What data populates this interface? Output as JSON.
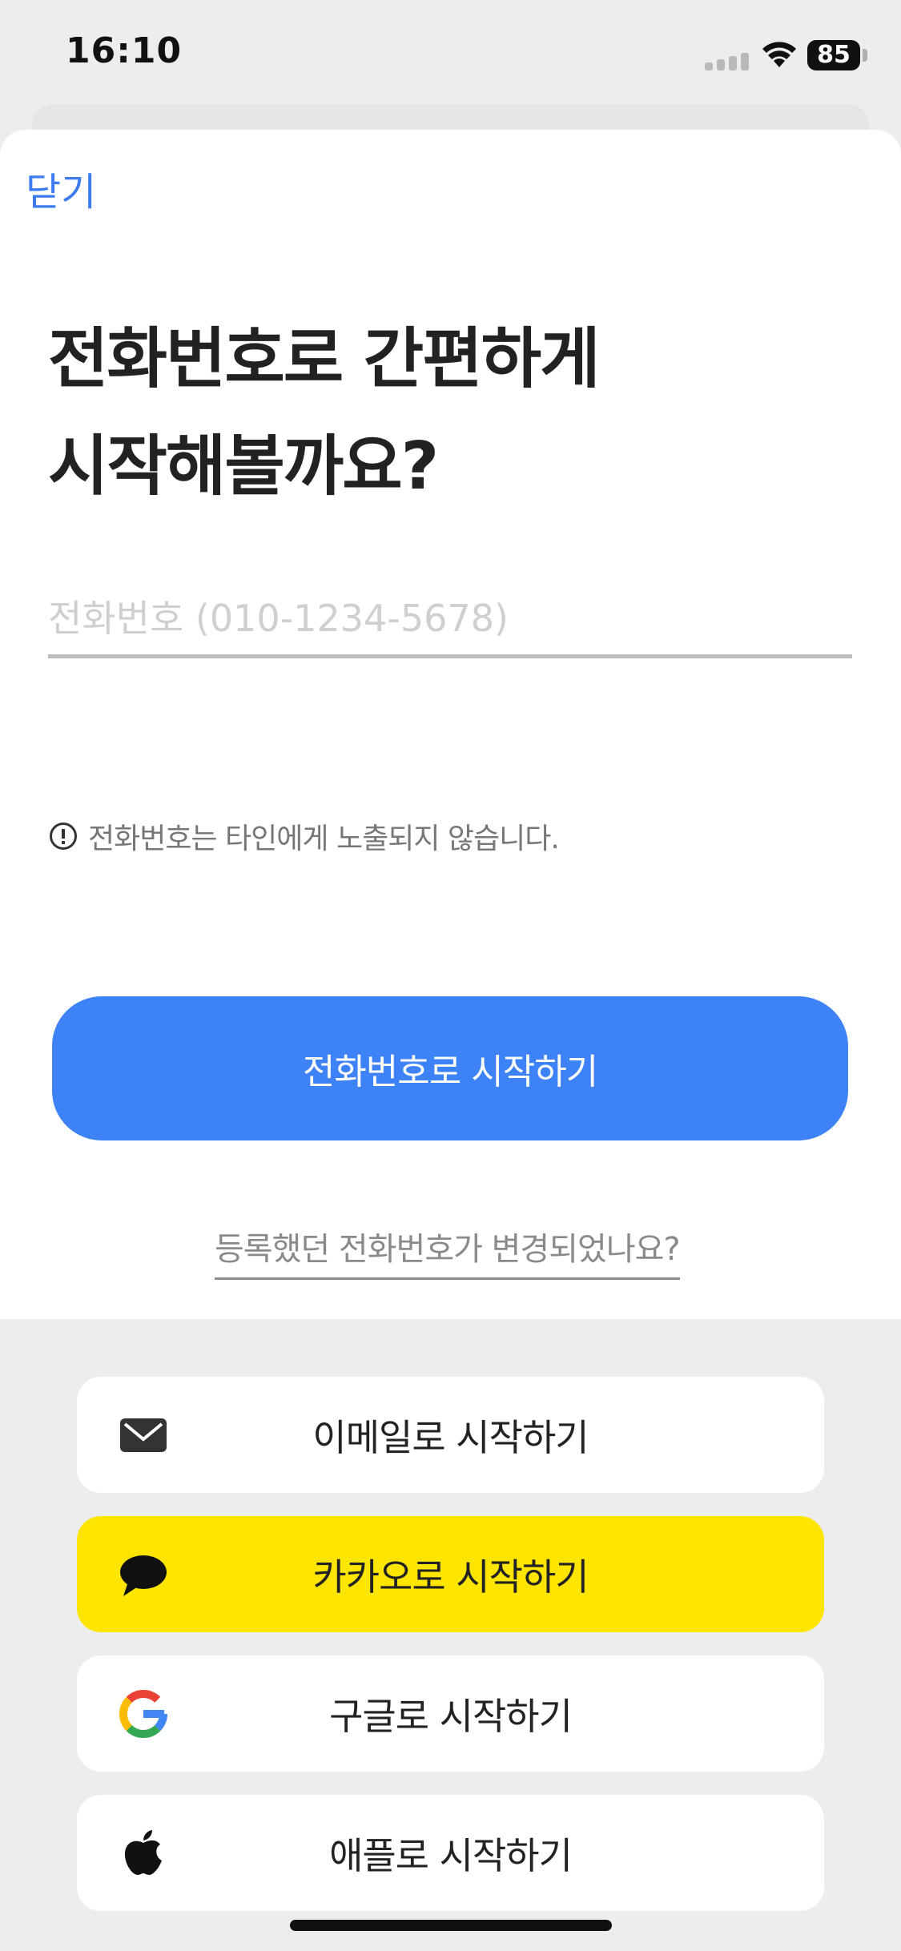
{
  "status_bar": {
    "time": "16:10",
    "battery": "85"
  },
  "header": {
    "close_label": "닫기"
  },
  "main": {
    "title_line1": "전화번호로 간편하게",
    "title_line2": "시작해볼까요?",
    "phone_placeholder": "전화번호 (010-1234-5678)",
    "phone_value": "",
    "notice": "전화번호는 타인에게 노출되지 않습니다.",
    "start_button": "전화번호로 시작하기",
    "changed_link": "등록했던 전화번호가 변경되었나요?"
  },
  "social": {
    "email_label": "이메일로 시작하기",
    "kakao_label": "카카오로 시작하기",
    "google_label": "구글로 시작하기",
    "apple_label": "애플로 시작하기"
  },
  "colors": {
    "accent": "#3e82f7",
    "kakao": "#fde500",
    "background": "#ededed"
  },
  "icons": [
    "wifi-icon",
    "info-icon",
    "mail-icon",
    "kakao-chat-icon",
    "google-icon",
    "apple-icon"
  ]
}
